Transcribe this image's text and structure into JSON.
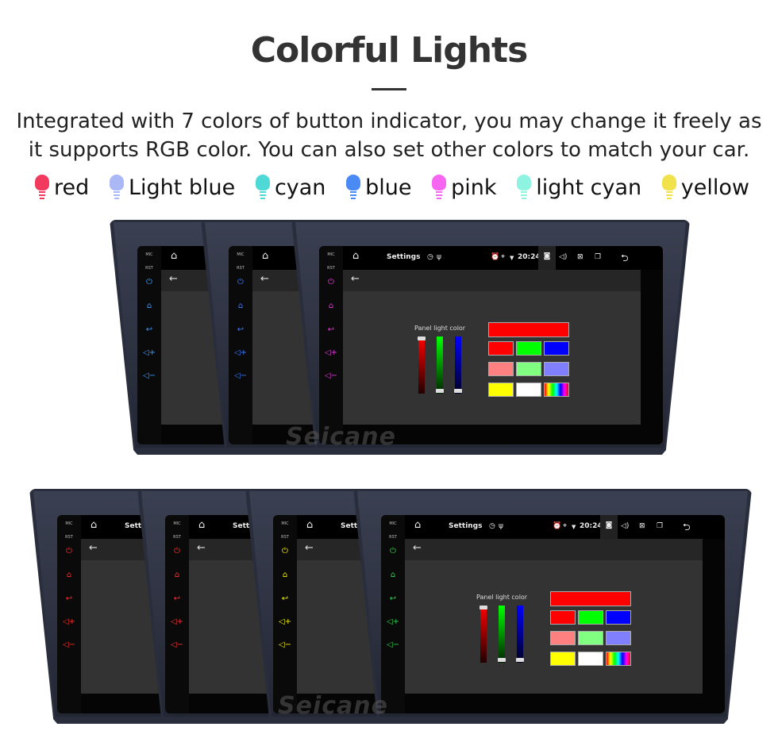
{
  "title": "Colorful Lights",
  "subtitle": {
    "line1": "Integrated with 7 colors of button indicator, you may change it freely as",
    "line2": "it supports RGB color. You can also set other colors to match your car."
  },
  "legend": [
    {
      "label": "red",
      "color": "#f23a5e"
    },
    {
      "label": "Light blue",
      "color": "#aab8f5"
    },
    {
      "label": "cyan",
      "color": "#4fd9d6"
    },
    {
      "label": "blue",
      "color": "#4a8af4"
    },
    {
      "label": "pink",
      "color": "#f766f0"
    },
    {
      "label": "light cyan",
      "color": "#8ff3e2"
    },
    {
      "label": "yellow",
      "color": "#f1e24c"
    }
  ],
  "screen": {
    "mic": "MIC",
    "rst": "RST",
    "app_title": "Settings",
    "time": "20:24",
    "back_arrow": "←",
    "panel_label": "Panel light color",
    "side_icons": [
      "power-icon",
      "home-icon",
      "back-icon",
      "volume-up-icon",
      "volume-down-icon"
    ],
    "side_glyphs": [
      "⏻",
      "⌂",
      "↩",
      "◁+",
      "◁−"
    ],
    "status_icons": {
      "home": "⌂",
      "timer": "◷",
      "usb": "ψ",
      "alarm": "⏰",
      "location": "⌖",
      "wifi": "▼",
      "camera": "◙",
      "volume": "◁)",
      "close": "⊠",
      "windows": "❐",
      "return": "⮌"
    },
    "swatch_top": "#ff0000",
    "swatches": [
      "#ff0000",
      "#00ff00",
      "#0000ff",
      "#ff8080",
      "#80ff80",
      "#8080ff",
      "#ffff00",
      "#ffffff",
      "rainbow"
    ]
  },
  "units": [
    {
      "row": "top",
      "button_color": "#3a9bff"
    },
    {
      "row": "top",
      "button_color": "#3a7bff"
    },
    {
      "row": "top",
      "button_color": "#e43ad8"
    },
    {
      "row": "bottom",
      "button_color": "#ff2a2a"
    },
    {
      "row": "bottom",
      "button_color": "#ff3030"
    },
    {
      "row": "bottom",
      "button_color": "#f4f000"
    },
    {
      "row": "bottom",
      "button_color": "#2fd24a"
    }
  ],
  "watermark": "Seicane"
}
